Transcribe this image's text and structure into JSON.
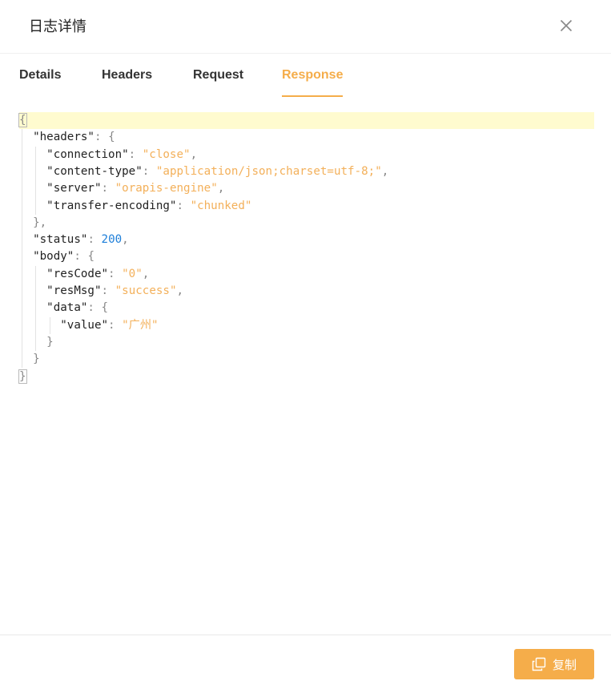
{
  "modal": {
    "title": "日志详情",
    "close_icon": "close-icon"
  },
  "tabs": [
    {
      "label": "Details",
      "active": false
    },
    {
      "label": "Headers",
      "active": false
    },
    {
      "label": "Request",
      "active": false
    },
    {
      "label": "Response",
      "active": true
    }
  ],
  "response_json": {
    "headers": {
      "connection": "close",
      "content-type": "application/json;charset=utf-8;",
      "server": "orapis-engine",
      "transfer-encoding": "chunked"
    },
    "status": 200,
    "body": {
      "resCode": "0",
      "resMsg": "success",
      "data": {
        "value": "广州"
      }
    }
  },
  "footer": {
    "copy_label": "复制",
    "copy_icon": "copy-icon"
  },
  "colors": {
    "accent": "#f5ad4a",
    "string": "#f3b05a",
    "number": "#1e7fd9",
    "highlight": "#fffbcf"
  }
}
